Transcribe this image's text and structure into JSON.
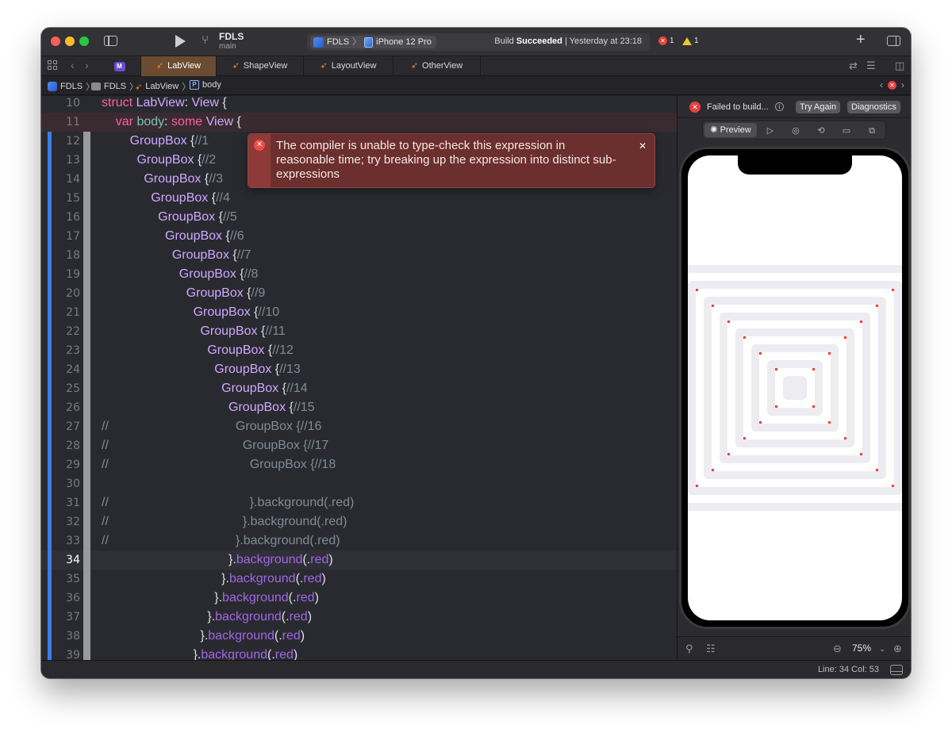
{
  "titlebar": {
    "project": "FDLS",
    "branch": "main",
    "scheme": "FDLS",
    "device": "iPhone 12 Pro",
    "build_prefix": "Build ",
    "build_result": "Succeeded",
    "build_time": " | Yesterday at 23:18",
    "error_count": "1",
    "warning_count": "1"
  },
  "tabs": [
    {
      "label": "LabView",
      "active": true
    },
    {
      "label": "ShapeView",
      "active": false
    },
    {
      "label": "LayoutView",
      "active": false
    },
    {
      "label": "OtherView",
      "active": false
    }
  ],
  "jumpbar": {
    "items": [
      "FDLS",
      "FDLS",
      "LabView",
      "body"
    ]
  },
  "editor": {
    "current_line": 34,
    "lines": [
      {
        "n": "10",
        "indent": "",
        "code": [
          [
            "kw",
            "struct "
          ],
          [
            "ty",
            "LabView"
          ],
          [
            "pl",
            ": "
          ],
          [
            "ty",
            "View"
          ],
          [
            "pl",
            " {"
          ]
        ]
      },
      {
        "n": "11",
        "indent": "    ",
        "code": [
          [
            "kw",
            "var "
          ],
          [
            "id",
            "body"
          ],
          [
            "pl",
            ": "
          ],
          [
            "kw",
            "some "
          ],
          [
            "ty",
            "View"
          ],
          [
            "pl",
            " {"
          ]
        ]
      },
      {
        "n": "12",
        "indent": "        ",
        "code": [
          [
            "ty",
            "GroupBox"
          ],
          [
            "pl",
            " {"
          ],
          [
            "cm",
            "//1"
          ]
        ]
      },
      {
        "n": "13",
        "indent": "          ",
        "code": [
          [
            "ty",
            "GroupBox"
          ],
          [
            "pl",
            " {"
          ],
          [
            "cm",
            "//2"
          ]
        ]
      },
      {
        "n": "14",
        "indent": "            ",
        "code": [
          [
            "ty",
            "GroupBox"
          ],
          [
            "pl",
            " {"
          ],
          [
            "cm",
            "//3"
          ]
        ]
      },
      {
        "n": "15",
        "indent": "              ",
        "code": [
          [
            "ty",
            "GroupBox"
          ],
          [
            "pl",
            " {"
          ],
          [
            "cm",
            "//4"
          ]
        ]
      },
      {
        "n": "16",
        "indent": "                ",
        "code": [
          [
            "ty",
            "GroupBox"
          ],
          [
            "pl",
            " {"
          ],
          [
            "cm",
            "//5"
          ]
        ]
      },
      {
        "n": "17",
        "indent": "                  ",
        "code": [
          [
            "ty",
            "GroupBox"
          ],
          [
            "pl",
            " {"
          ],
          [
            "cm",
            "//6"
          ]
        ]
      },
      {
        "n": "18",
        "indent": "                    ",
        "code": [
          [
            "ty",
            "GroupBox"
          ],
          [
            "pl",
            " {"
          ],
          [
            "cm",
            "//7"
          ]
        ]
      },
      {
        "n": "19",
        "indent": "                      ",
        "code": [
          [
            "ty",
            "GroupBox"
          ],
          [
            "pl",
            " {"
          ],
          [
            "cm",
            "//8"
          ]
        ]
      },
      {
        "n": "20",
        "indent": "                        ",
        "code": [
          [
            "ty",
            "GroupBox"
          ],
          [
            "pl",
            " {"
          ],
          [
            "cm",
            "//9"
          ]
        ]
      },
      {
        "n": "21",
        "indent": "                          ",
        "code": [
          [
            "ty",
            "GroupBox"
          ],
          [
            "pl",
            " {"
          ],
          [
            "cm",
            "//10"
          ]
        ]
      },
      {
        "n": "22",
        "indent": "                            ",
        "code": [
          [
            "ty",
            "GroupBox"
          ],
          [
            "pl",
            " {"
          ],
          [
            "cm",
            "//11"
          ]
        ]
      },
      {
        "n": "23",
        "indent": "                              ",
        "code": [
          [
            "ty",
            "GroupBox"
          ],
          [
            "pl",
            " {"
          ],
          [
            "cm",
            "//12"
          ]
        ]
      },
      {
        "n": "24",
        "indent": "                                ",
        "code": [
          [
            "ty",
            "GroupBox"
          ],
          [
            "pl",
            " {"
          ],
          [
            "cm",
            "//13"
          ]
        ]
      },
      {
        "n": "25",
        "indent": "                                  ",
        "code": [
          [
            "ty",
            "GroupBox"
          ],
          [
            "pl",
            " {"
          ],
          [
            "cm",
            "//14"
          ]
        ]
      },
      {
        "n": "26",
        "indent": "                                    ",
        "code": [
          [
            "ty",
            "GroupBox"
          ],
          [
            "pl",
            " {"
          ],
          [
            "cm",
            "//15"
          ]
        ]
      },
      {
        "n": "27",
        "indent": "",
        "code": [
          [
            "cm",
            "//                                    GroupBox {//16"
          ]
        ]
      },
      {
        "n": "28",
        "indent": "",
        "code": [
          [
            "cm",
            "//                                      GroupBox {//17"
          ]
        ]
      },
      {
        "n": "29",
        "indent": "",
        "code": [
          [
            "cm",
            "//                                        GroupBox {//18"
          ]
        ]
      },
      {
        "n": "30",
        "indent": "",
        "code": []
      },
      {
        "n": "31",
        "indent": "",
        "code": [
          [
            "cm",
            "//                                        }.background(.red)"
          ]
        ]
      },
      {
        "n": "32",
        "indent": "",
        "code": [
          [
            "cm",
            "//                                      }.background(.red)"
          ]
        ]
      },
      {
        "n": "33",
        "indent": "",
        "code": [
          [
            "cm",
            "//                                    }.background(.red)"
          ]
        ]
      },
      {
        "n": "34",
        "indent": "                                    ",
        "code": [
          [
            "pl",
            "}."
          ],
          [
            "mt",
            "background"
          ],
          [
            "pl",
            "(."
          ],
          [
            "mt",
            "red"
          ],
          [
            "pl",
            ")"
          ]
        ]
      },
      {
        "n": "35",
        "indent": "                                  ",
        "code": [
          [
            "pl",
            "}."
          ],
          [
            "mt",
            "background"
          ],
          [
            "pl",
            "(."
          ],
          [
            "mt",
            "red"
          ],
          [
            "pl",
            ")"
          ]
        ]
      },
      {
        "n": "36",
        "indent": "                                ",
        "code": [
          [
            "pl",
            "}."
          ],
          [
            "mt",
            "background"
          ],
          [
            "pl",
            "(."
          ],
          [
            "mt",
            "red"
          ],
          [
            "pl",
            ")"
          ]
        ]
      },
      {
        "n": "37",
        "indent": "                              ",
        "code": [
          [
            "pl",
            "}."
          ],
          [
            "mt",
            "background"
          ],
          [
            "pl",
            "(."
          ],
          [
            "mt",
            "red"
          ],
          [
            "pl",
            ")"
          ]
        ]
      },
      {
        "n": "38",
        "indent": "                            ",
        "code": [
          [
            "pl",
            "}."
          ],
          [
            "mt",
            "background"
          ],
          [
            "pl",
            "(."
          ],
          [
            "mt",
            "red"
          ],
          [
            "pl",
            ")"
          ]
        ]
      },
      {
        "n": "39",
        "indent": "                          ",
        "code": [
          [
            "pl",
            "}."
          ],
          [
            "mt",
            "background"
          ],
          [
            "pl",
            "(."
          ],
          [
            "mt",
            "red"
          ],
          [
            "pl",
            ")"
          ]
        ]
      }
    ]
  },
  "error_popover": {
    "message": "The compiler is unable to type-check this expression in reasonable time; try breaking up the expression into distinct sub-expressions"
  },
  "preview": {
    "status": "Failed to build...",
    "try_again": "Try Again",
    "diagnostics": "Diagnostics",
    "preview_label": "Preview",
    "zoom": "75%",
    "nested_box_count": 15
  },
  "statusbar": {
    "cursor": "Line: 34  Col: 53"
  },
  "colors": {
    "accent_tab": "#6b4c32",
    "error": "#e5413c",
    "warning": "#f2c12e",
    "editor_bg": "#292a30"
  }
}
